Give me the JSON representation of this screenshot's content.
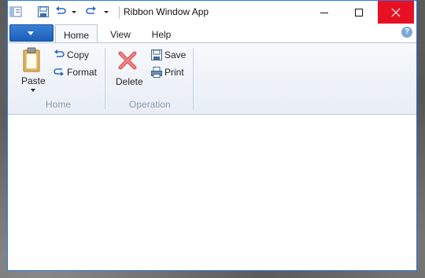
{
  "window": {
    "title": "Ribbon Window App",
    "controls": {
      "minimize": "minimize-icon",
      "maximize": "maximize-icon",
      "close": "close-icon"
    }
  },
  "quick_access": [
    "save-icon",
    "undo-icon",
    "dropdown-icon",
    "redo-icon",
    "customize-icon"
  ],
  "tabs": [
    {
      "label": "Home",
      "active": true
    },
    {
      "label": "View",
      "active": false
    },
    {
      "label": "Help",
      "active": false
    }
  ],
  "groups": {
    "home": {
      "label": "Home",
      "paste_label": "Paste",
      "copy_label": "Copy",
      "format_label": "Format"
    },
    "operation": {
      "label": "Operation",
      "delete_label": "Delete",
      "save_label": "Save",
      "print_label": "Print"
    }
  },
  "colors": {
    "accent": "#2b79d8",
    "close": "#e81123",
    "app_menu": "#1c5fb8",
    "group_label": "#8a9bb0"
  }
}
